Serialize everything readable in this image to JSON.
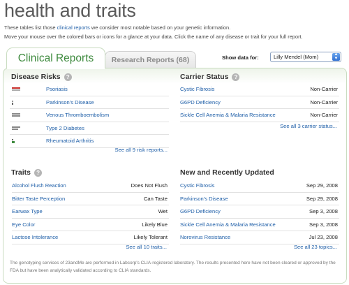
{
  "page": {
    "title": "health and traits",
    "intro_line1_prefix": "These tables list those ",
    "intro_link": "clinical reports",
    "intro_line1_suffix": " we consider most notable based on your genetic information.",
    "intro_line2": "Move your mouse over the colored bars or icons for a glance at your data. Click the name of any disease or trait for your full report."
  },
  "tabs": {
    "clinical": "Clinical Reports",
    "research": "Research Reports (68)"
  },
  "show_data": {
    "label": "Show data for:",
    "selected": "Lilly Mendel (Mom)"
  },
  "disease_risks": {
    "title": "Disease Risks",
    "items": [
      {
        "name": "Psoriasis",
        "icon": "risk-bar-red"
      },
      {
        "name": "Parkinson's Disease",
        "icon": "risk-bar-small"
      },
      {
        "name": "Venous Thromboembolism",
        "icon": "risk-bar-gray"
      },
      {
        "name": "Type 2 Diabetes",
        "icon": "risk-bar-gray"
      },
      {
        "name": "Rheumatoid Arthritis",
        "icon": "risk-bar-green"
      }
    ],
    "see_all": "See all 9 risk reports..."
  },
  "carrier_status": {
    "title": "Carrier Status",
    "items": [
      {
        "name": "Cystic Fibrosis",
        "value": "Non-Carrier"
      },
      {
        "name": "G6PD Deficiency",
        "value": "Non-Carrier"
      },
      {
        "name": "Sickle Cell Anemia & Malaria Resistance",
        "value": "Non-Carrier"
      }
    ],
    "see_all": "See all 3 carrier status..."
  },
  "traits": {
    "title": "Traits",
    "items": [
      {
        "name": "Alcohol Flush Reaction",
        "value": "Does Not Flush"
      },
      {
        "name": "Bitter Taste Perception",
        "value": "Can Taste"
      },
      {
        "name": "Earwax Type",
        "value": "Wet"
      },
      {
        "name": "Eye Color",
        "value": "Likely Blue"
      },
      {
        "name": "Lactose Intolerance",
        "value": "Likely Tolerant"
      }
    ],
    "see_all": "See all 10 traits..."
  },
  "recent": {
    "title": "New and Recently Updated",
    "items": [
      {
        "name": "Cystic Fibrosis",
        "value": "Sep 29, 2008"
      },
      {
        "name": "Parkinson's Disease",
        "value": "Sep 29, 2008"
      },
      {
        "name": "G6PD Deficiency",
        "value": "Sep 3, 2008"
      },
      {
        "name": "Sickle Cell Anemia & Malaria Resistance",
        "value": "Sep 3, 2008"
      },
      {
        "name": "Norovirus Resistance",
        "value": "Jul 23, 2008"
      }
    ],
    "see_all": "See all 23 topics..."
  },
  "footer": {
    "note": "The genotyping services of 23andMe are performed in Labcorp's CLIA-registered laboratory. The results presented here have not been cleared or approved by the FDA but have been analytically validated according to CLIA standards."
  },
  "colors": {
    "link": "#1f5fa8",
    "tab_active": "#3d8a3d",
    "risk_red": "#c9302c",
    "risk_gray": "#888888",
    "risk_green": "#3d8a3d"
  }
}
